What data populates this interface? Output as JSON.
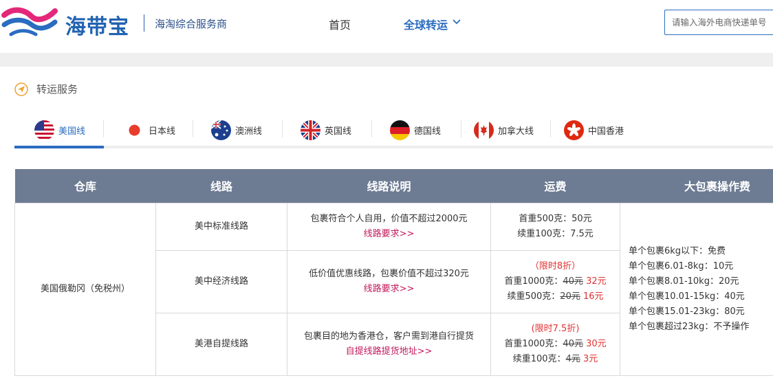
{
  "header": {
    "brand": "海带宝",
    "tagline": "海淘综合服务商",
    "nav_home": "首页",
    "nav_global": "全球转运",
    "search_placeholder": "请输入海外电商快递单号"
  },
  "section": {
    "title": "转运服务"
  },
  "tabs": [
    {
      "label": "美国线",
      "flag": "us-flag-icon",
      "active": true
    },
    {
      "label": "日本线",
      "flag": "japan-flag-icon"
    },
    {
      "label": "澳洲线",
      "flag": "australia-flag-icon"
    },
    {
      "label": "英国线",
      "flag": "uk-flag-icon"
    },
    {
      "label": "德国线",
      "flag": "germany-flag-icon"
    },
    {
      "label": "加拿大线",
      "flag": "canada-flag-icon"
    },
    {
      "label": "中国香港",
      "flag": "hongkong-flag-icon"
    }
  ],
  "table": {
    "headers": [
      "仓库",
      "线路",
      "线路说明",
      "运费",
      "大包裹操作费"
    ],
    "warehouse": "美国俄勒冈（免税州）",
    "rows": [
      {
        "route": "美中标准线路",
        "desc": "包裹符合个人自用，价值不超过2000元",
        "link": "线路要求>>",
        "promo": "",
        "first": "首重500克：50元",
        "next": "续重100克：7.5元"
      },
      {
        "route": "美中经济线路",
        "desc": "低价值优惠线路，包裹价值不超过320元",
        "link": "线路要求>>",
        "promo": "（限时8折）",
        "first_label": "首重1000克：",
        "first_orig": "40元",
        "first_new": "32元",
        "next_label": "续重500克：",
        "next_orig": "20元",
        "next_new": "16元"
      },
      {
        "route": "美港自提线路",
        "desc": "包裹目的地为香港仓，客户需到港自行提货",
        "link": "自提线路提货地址>>",
        "promo": "(限时7.5折)",
        "first_label": "首重1000克：",
        "first_orig": "40元",
        "first_new": "30元",
        "next_label": "续重100克：",
        "next_orig": "4元",
        "next_new": "3元"
      }
    ],
    "large_fees": [
      "单个包裹6kg以下：免费",
      "单个包裹6.01-8kg：10元",
      "单个包裹8.01-10kg：20元",
      "单个包裹10.01-15kg：40元",
      "单个包裹15.01-23kg：80元",
      "单个包裹超过23kg：不予操作"
    ]
  }
}
